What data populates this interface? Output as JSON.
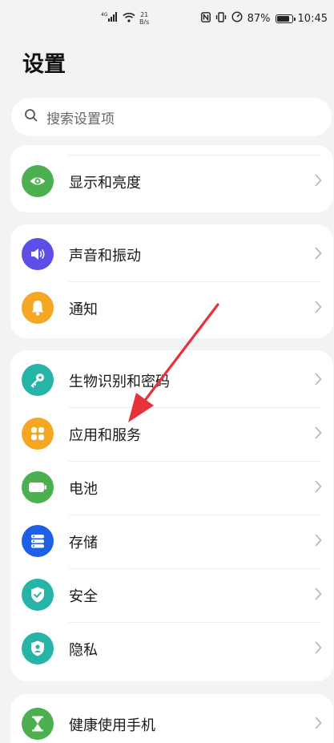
{
  "status_bar": {
    "signal": "4G",
    "net_speed_value": "21",
    "net_speed_unit": "B/s",
    "battery": "87%",
    "time": "10:45"
  },
  "page": {
    "title": "设置"
  },
  "search": {
    "placeholder": "搜索设置项"
  },
  "groups": [
    {
      "items": [
        {
          "label": "显示和亮度",
          "icon": "eye-icon",
          "color": "#4caf50"
        }
      ]
    },
    {
      "items": [
        {
          "label": "声音和振动",
          "icon": "speaker-icon",
          "color": "#5b4fe6"
        },
        {
          "label": "通知",
          "icon": "bell-icon",
          "color": "#f5a623"
        }
      ]
    },
    {
      "items": [
        {
          "label": "生物识别和密码",
          "icon": "key-icon",
          "color": "#26b3a8"
        },
        {
          "label": "应用和服务",
          "icon": "apps-grid-icon",
          "color": "#f5a623"
        },
        {
          "label": "电池",
          "icon": "battery-icon",
          "color": "#4caf50"
        },
        {
          "label": "存储",
          "icon": "storage-icon",
          "color": "#1f5fe6"
        },
        {
          "label": "安全",
          "icon": "shield-check-icon",
          "color": "#26b3a8"
        },
        {
          "label": "隐私",
          "icon": "privacy-person-icon",
          "color": "#26b3a8"
        }
      ]
    },
    {
      "items": [
        {
          "label": "健康使用手机",
          "icon": "hourglass-icon",
          "color": "#4caf50"
        }
      ]
    }
  ],
  "annotation": {
    "color": "#e8323a"
  }
}
